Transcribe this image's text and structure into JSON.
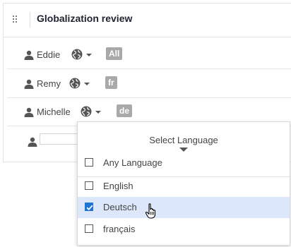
{
  "panel": {
    "title": "Globalization review"
  },
  "users": [
    {
      "name": "Eddie",
      "language": "All"
    },
    {
      "name": "Remy",
      "language": "fr"
    },
    {
      "name": "Michelle",
      "language": "de"
    }
  ],
  "new_user": {
    "value": ""
  },
  "language_dropdown": {
    "title": "Select Language",
    "options": [
      {
        "label": "Any Language",
        "checked": false
      },
      {
        "label": "English",
        "checked": false
      },
      {
        "label": "Deutsch",
        "checked": true
      },
      {
        "label": "français",
        "checked": false
      }
    ]
  },
  "colors": {
    "badge": "#a9a9a9",
    "accent": "#1f73d4",
    "selected_row": "#dce7fb",
    "title": "#1e2231"
  },
  "icons": {
    "drag": "drag-handle-icon",
    "person": "person-icon",
    "globe": "globe-icon",
    "caret": "caret-down-icon",
    "check": "check-icon",
    "cursor": "hand-pointer-icon"
  }
}
